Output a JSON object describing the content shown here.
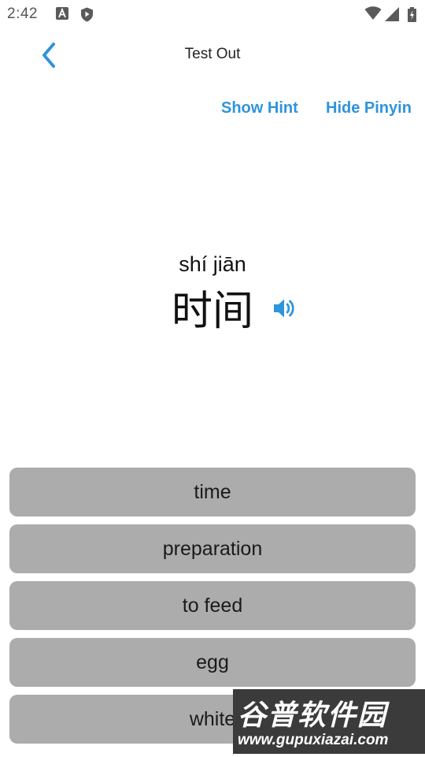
{
  "status_bar": {
    "time": "2:42",
    "icons": [
      "a-badge-icon",
      "shield-play-icon",
      "wifi-icon",
      "signal-icon",
      "battery-charging-icon"
    ]
  },
  "header": {
    "title": "Test Out",
    "back_icon": "chevron-left-icon"
  },
  "actions": {
    "show_hint": "Show Hint",
    "hide_pinyin": "Hide Pinyin"
  },
  "word": {
    "pinyin": "shí jiān",
    "hanzi": "时间",
    "speaker_icon": "speaker-icon"
  },
  "options": [
    {
      "label": "time"
    },
    {
      "label": "preparation"
    },
    {
      "label": "to feed"
    },
    {
      "label": "egg"
    },
    {
      "label": "white"
    }
  ],
  "watermark": {
    "logo": "谷普软件园",
    "url": "www.gupuxiazai.com"
  },
  "colors": {
    "accent": "#2e94dc",
    "option_bg": "#acacac",
    "watermark_bg": "#3b3b3b"
  }
}
